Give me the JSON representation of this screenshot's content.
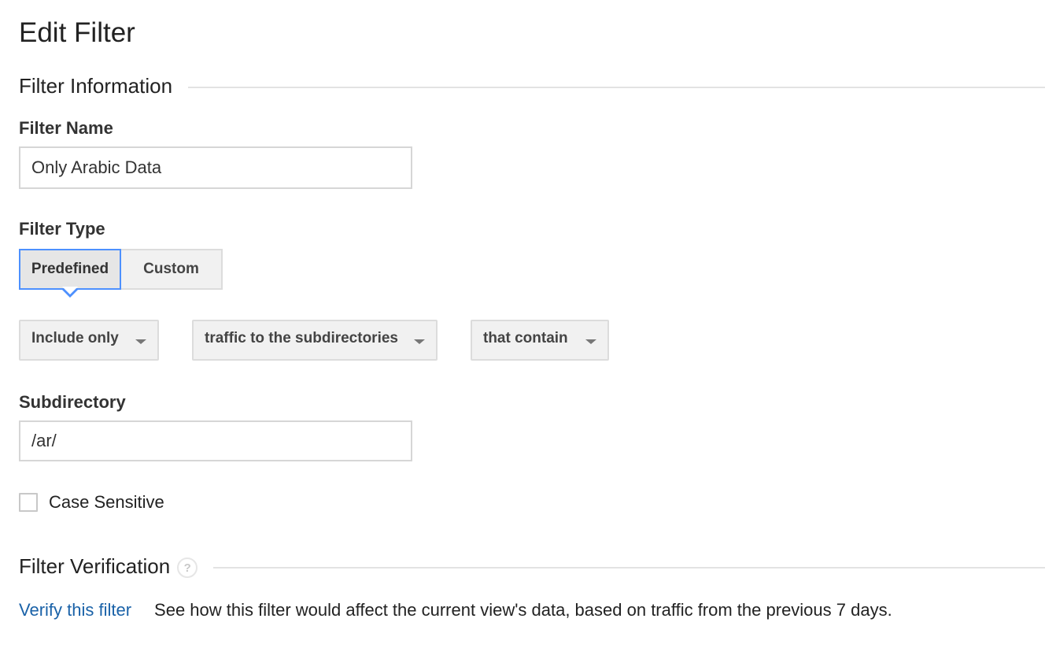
{
  "page": {
    "title": "Edit Filter"
  },
  "filter_information": {
    "section_title": "Filter Information",
    "filter_name": {
      "label": "Filter Name",
      "value": "Only Arabic Data",
      "placeholder": ""
    },
    "filter_type": {
      "label": "Filter Type",
      "options": [
        {
          "label": "Predefined",
          "selected": true
        },
        {
          "label": "Custom",
          "selected": false
        }
      ],
      "dropdowns": [
        {
          "name": "include-exclude",
          "value": "Include only"
        },
        {
          "name": "source-type",
          "value": "traffic to the subdirectories"
        },
        {
          "name": "match-expression",
          "value": "that contain"
        }
      ]
    },
    "subdirectory": {
      "label": "Subdirectory",
      "value": "/ar/",
      "placeholder": ""
    },
    "case_sensitive": {
      "label": "Case Sensitive",
      "checked": false
    }
  },
  "filter_verification": {
    "section_title": "Filter Verification",
    "help_icon": "help-circle-icon",
    "help_glyph": "?",
    "link_label": "Verify this filter",
    "description": "See how this filter would affect the current view's data, based on traffic from the previous 7 days."
  },
  "colors": {
    "accent_blue": "#4d90fe",
    "link_blue": "#1a62a8",
    "button_bg": "#f1f1f1",
    "text_dark": "#222222"
  }
}
